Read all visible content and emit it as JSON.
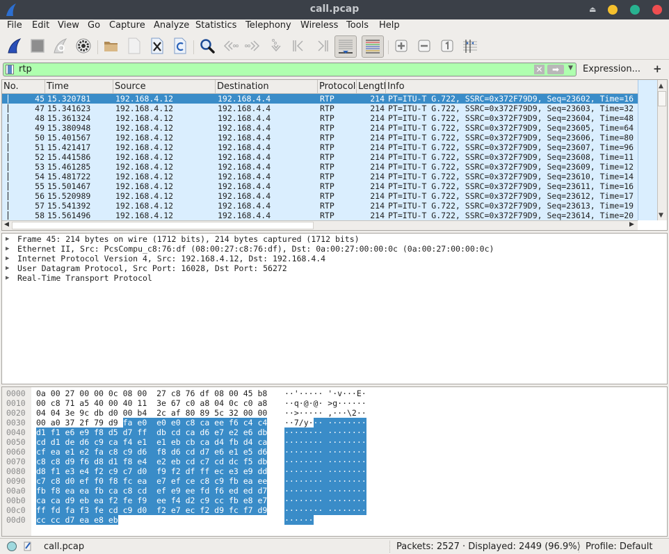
{
  "window": {
    "title": "call.pcap",
    "controls": {
      "minimize_color": "#f5c02d",
      "maximize_color": "#28b290",
      "close_color": "#ef4e50"
    }
  },
  "menu": [
    {
      "label": "File"
    },
    {
      "label": "Edit"
    },
    {
      "label": "View"
    },
    {
      "label": "Go"
    },
    {
      "label": "Capture"
    },
    {
      "label": "Analyze"
    },
    {
      "label": "Statistics"
    },
    {
      "label": "Telephony"
    },
    {
      "label": "Wireless"
    },
    {
      "label": "Tools"
    },
    {
      "label": "Help"
    }
  ],
  "toolbar": {
    "buttons": [
      "start-capture",
      "stop-capture",
      "restart-capture",
      "capture-options",
      "open-file",
      "save-file",
      "close-file",
      "reload-file",
      "find-packet",
      "go-back",
      "go-forward",
      "go-to-packet",
      "go-first-packet",
      "go-last-packet",
      "auto-scroll",
      "colorize",
      "zoom-in",
      "zoom-out",
      "normal-size",
      "resize-columns"
    ]
  },
  "filter": {
    "value": "rtp",
    "expression_label": "Expression...",
    "add_label": "+",
    "background": "#afffaf"
  },
  "packet_list": {
    "columns": [
      "No.",
      "Time",
      "Source",
      "Destination",
      "Protocol",
      "Length",
      "Info"
    ],
    "rows": [
      {
        "no": "45",
        "time": "15.320781",
        "src": "192.168.4.12",
        "dst": "192.168.4.4",
        "proto": "RTP",
        "len": "214",
        "info": "PT=ITU-T G.722, SSRC=0x372F79D9, Seq=23602, Time=16",
        "selected": true
      },
      {
        "no": "47",
        "time": "15.341623",
        "src": "192.168.4.12",
        "dst": "192.168.4.4",
        "proto": "RTP",
        "len": "214",
        "info": "PT=ITU-T G.722, SSRC=0x372F79D9, Seq=23603, Time=32"
      },
      {
        "no": "48",
        "time": "15.361324",
        "src": "192.168.4.12",
        "dst": "192.168.4.4",
        "proto": "RTP",
        "len": "214",
        "info": "PT=ITU-T G.722, SSRC=0x372F79D9, Seq=23604, Time=48"
      },
      {
        "no": "49",
        "time": "15.380948",
        "src": "192.168.4.12",
        "dst": "192.168.4.4",
        "proto": "RTP",
        "len": "214",
        "info": "PT=ITU-T G.722, SSRC=0x372F79D9, Seq=23605, Time=64"
      },
      {
        "no": "50",
        "time": "15.401567",
        "src": "192.168.4.12",
        "dst": "192.168.4.4",
        "proto": "RTP",
        "len": "214",
        "info": "PT=ITU-T G.722, SSRC=0x372F79D9, Seq=23606, Time=80"
      },
      {
        "no": "51",
        "time": "15.421417",
        "src": "192.168.4.12",
        "dst": "192.168.4.4",
        "proto": "RTP",
        "len": "214",
        "info": "PT=ITU-T G.722, SSRC=0x372F79D9, Seq=23607, Time=96"
      },
      {
        "no": "52",
        "time": "15.441586",
        "src": "192.168.4.12",
        "dst": "192.168.4.4",
        "proto": "RTP",
        "len": "214",
        "info": "PT=ITU-T G.722, SSRC=0x372F79D9, Seq=23608, Time=11"
      },
      {
        "no": "53",
        "time": "15.461285",
        "src": "192.168.4.12",
        "dst": "192.168.4.4",
        "proto": "RTP",
        "len": "214",
        "info": "PT=ITU-T G.722, SSRC=0x372F79D9, Seq=23609, Time=12"
      },
      {
        "no": "54",
        "time": "15.481722",
        "src": "192.168.4.12",
        "dst": "192.168.4.4",
        "proto": "RTP",
        "len": "214",
        "info": "PT=ITU-T G.722, SSRC=0x372F79D9, Seq=23610, Time=14"
      },
      {
        "no": "55",
        "time": "15.501467",
        "src": "192.168.4.12",
        "dst": "192.168.4.4",
        "proto": "RTP",
        "len": "214",
        "info": "PT=ITU-T G.722, SSRC=0x372F79D9, Seq=23611, Time=16"
      },
      {
        "no": "56",
        "time": "15.520989",
        "src": "192.168.4.12",
        "dst": "192.168.4.4",
        "proto": "RTP",
        "len": "214",
        "info": "PT=ITU-T G.722, SSRC=0x372F79D9, Seq=23612, Time=17"
      },
      {
        "no": "57",
        "time": "15.541392",
        "src": "192.168.4.12",
        "dst": "192.168.4.4",
        "proto": "RTP",
        "len": "214",
        "info": "PT=ITU-T G.722, SSRC=0x372F79D9, Seq=23613, Time=19"
      },
      {
        "no": "58",
        "time": "15.561496",
        "src": "192.168.4.12",
        "dst": "192.168.4.4",
        "proto": "RTP",
        "len": "214",
        "info": "PT=ITU-T G.722, SSRC=0x372F79D9, Seq=23614, Time=20"
      }
    ],
    "row_color": "#daeefe",
    "selected_color": "#3a8cc8"
  },
  "details": [
    "Frame 45: 214 bytes on wire (1712 bits), 214 bytes captured (1712 bits)",
    "Ethernet II, Src: PcsCompu_c8:76:df (08:00:27:c8:76:df), Dst: 0a:00:27:00:00:0c (0a:00:27:00:00:0c)",
    "Internet Protocol Version 4, Src: 192.168.4.12, Dst: 192.168.4.4",
    "User Datagram Protocol, Src Port: 16028, Dst Port: 56272",
    "Real-Time Transport Protocol"
  ],
  "bytes": [
    {
      "offset": "0000",
      "plain_hex": "0a 00 27 00 00 0c 08 00  27 c8 76 df 08 00 45 b8",
      "hl_hex": "",
      "plain_ascii": "··'····· '·v···E·",
      "hl_ascii": ""
    },
    {
      "offset": "0010",
      "plain_hex": "00 c8 71 a5 40 00 40 11  3e 67 c0 a8 04 0c c0 a8",
      "hl_hex": "",
      "plain_ascii": "··q·@·@· >g······",
      "hl_ascii": ""
    },
    {
      "offset": "0020",
      "plain_hex": "04 04 3e 9c db d0 00 b4  2c af 80 89 5c 32 00 00",
      "hl_hex": "",
      "plain_ascii": "··>····· ,···\\2··",
      "hl_ascii": ""
    },
    {
      "offset": "0030",
      "plain_hex": "00 a0 37 2f 79 d9 ",
      "hl_hex": "fa e0  e0 e0 c8 ca ee f6 c4 c4",
      "plain_ascii": "··7/y·",
      "hl_ascii": "·· ········"
    },
    {
      "offset": "0040",
      "plain_hex": "",
      "hl_hex": "d1 f1 e6 e9 f8 d5 d7 ff  db cd ca d6 e7 e2 e6 db",
      "plain_ascii": "",
      "hl_ascii": "········ ········"
    },
    {
      "offset": "0050",
      "plain_hex": "",
      "hl_hex": "cd d1 de d6 c9 ca f4 e1  e1 eb cb ca d4 fb d4 ca",
      "plain_ascii": "",
      "hl_ascii": "········ ········"
    },
    {
      "offset": "0060",
      "plain_hex": "",
      "hl_hex": "cf ea e1 e2 fa c8 c9 d6  f8 d6 cd d7 e6 e1 e5 d6",
      "plain_ascii": "",
      "hl_ascii": "········ ········"
    },
    {
      "offset": "0070",
      "plain_hex": "",
      "hl_hex": "c8 c8 d9 f6 d8 d1 f8 e4  e2 eb cd c7 cd dc f5 db",
      "plain_ascii": "",
      "hl_ascii": "········ ········"
    },
    {
      "offset": "0080",
      "plain_hex": "",
      "hl_hex": "d8 f1 e3 e4 f2 c9 c7 d0  f9 f2 df ff ec e3 e9 dd",
      "plain_ascii": "",
      "hl_ascii": "········ ········"
    },
    {
      "offset": "0090",
      "plain_hex": "",
      "hl_hex": "c7 c8 d0 ef f0 f8 fc ea  e7 ef ce c8 c9 fb ea ee",
      "plain_ascii": "",
      "hl_ascii": "········ ········"
    },
    {
      "offset": "00a0",
      "plain_hex": "",
      "hl_hex": "fb f8 ea ea fb ca c8 cd  ef e9 ee fd f6 ed ed d7",
      "plain_ascii": "",
      "hl_ascii": "········ ········"
    },
    {
      "offset": "00b0",
      "plain_hex": "",
      "hl_hex": "ca ca d9 eb ea f2 fe f9  ee f4 d2 c9 cc fb e8 e7",
      "plain_ascii": "",
      "hl_ascii": "········ ········"
    },
    {
      "offset": "00c0",
      "plain_hex": "",
      "hl_hex": "ff fd fa f3 fe cd c9 d0  f2 e7 ec f2 d9 fc f7 d9",
      "plain_ascii": "",
      "hl_ascii": "········ ········"
    },
    {
      "offset": "00d0",
      "plain_hex": "",
      "hl_hex": "cc cc d7 ea e8 eb",
      "plain_ascii": "",
      "hl_ascii": "······"
    }
  ],
  "status": {
    "file": "call.pcap",
    "packets": "Packets: 2527 · Displayed: 2449 (96.9%)",
    "profile": "Profile: Default"
  }
}
